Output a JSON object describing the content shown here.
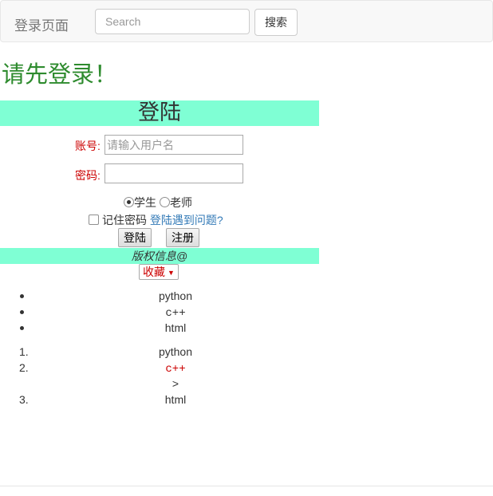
{
  "navbar": {
    "brand": "登录页面",
    "search_placeholder": "Search",
    "search_button": "搜索"
  },
  "headline": "请先登录！",
  "login_panel": {
    "title": "登陆",
    "account_label": "账号:",
    "account_placeholder": "请输入用户名",
    "password_label": "密码:",
    "roles": [
      {
        "label": "学生",
        "checked": true
      },
      {
        "label": "老师",
        "checked": false
      }
    ],
    "remember_label": "记住密码",
    "remember_checked": false,
    "help_link": "登陆遇到问题?",
    "login_button": "登陆",
    "register_button": "注册",
    "copyright": "版权信息@"
  },
  "favorite_select": {
    "selected": "收藏"
  },
  "unordered_list": [
    "python",
    "c++",
    "html"
  ],
  "ordered_list": [
    {
      "number": "1.",
      "text": "python"
    },
    {
      "number": "2.",
      "text": "c++"
    },
    {
      "number": "3.",
      "text": "html"
    }
  ],
  "stray_text": ">",
  "colors": {
    "accent_panel": "#7fffd4",
    "headline": "#2e8b2e",
    "label_red": "#cc0000",
    "link_blue": "#337ab7"
  }
}
